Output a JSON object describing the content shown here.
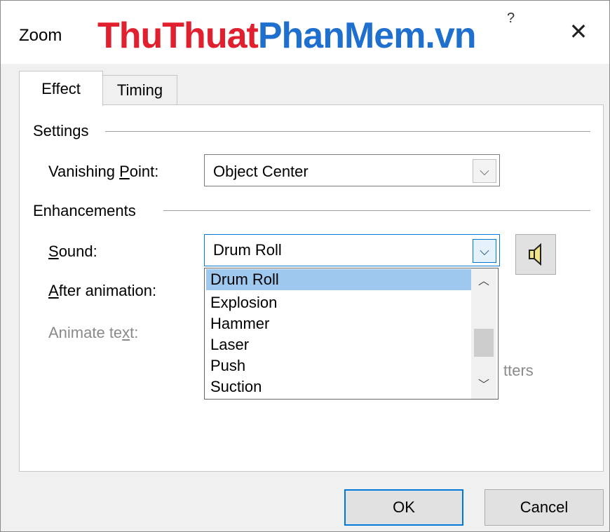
{
  "window": {
    "title": "Zoom",
    "help_glyph": "?",
    "close_glyph": "✕",
    "watermark_part1": "ThuThuat",
    "watermark_part2": "PhanMem.vn"
  },
  "tabs": [
    {
      "label": "Effect",
      "active": true
    },
    {
      "label": "Timing",
      "active": false
    }
  ],
  "settings": {
    "group_label": "Settings",
    "vanishing_point": {
      "label_pre": "Vanishing ",
      "label_accel": "P",
      "label_post": "oint:",
      "value": "Object Center"
    }
  },
  "enhancements": {
    "group_label": "Enhancements",
    "sound": {
      "label_accel": "S",
      "label_post": "ound:",
      "value": "Drum Roll",
      "options": [
        "Drum Roll",
        "Explosion",
        "Hammer",
        "Laser",
        "Push",
        "Suction"
      ],
      "selected_index": 0
    },
    "after_animation": {
      "label_accel": "A",
      "label_post": "fter animation:"
    },
    "animate_text": {
      "label_pre": "Animate te",
      "label_accel": "x",
      "label_post": "t:",
      "disabled": true
    },
    "letters_fragment": "tters"
  },
  "buttons": {
    "ok": "OK",
    "cancel": "Cancel"
  },
  "colors": {
    "accent": "#0078d7",
    "selection": "#9fc8ee",
    "watermark_red": "#e0202e",
    "watermark_blue": "#1f6fcf"
  }
}
